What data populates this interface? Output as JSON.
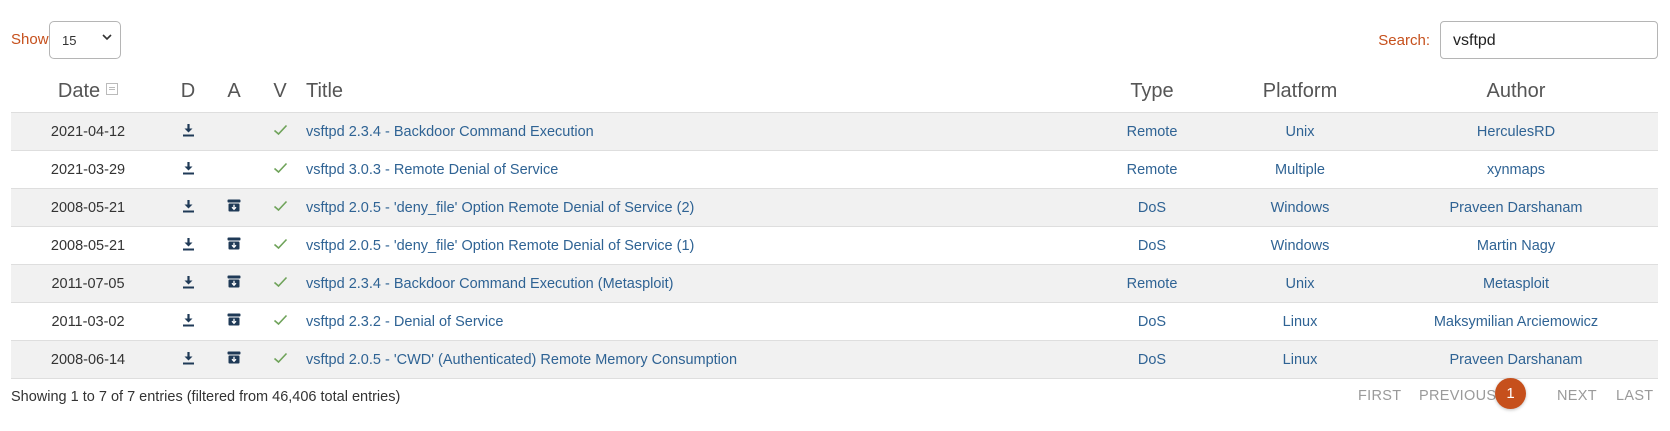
{
  "controls": {
    "show_label": "Show",
    "show_value": "15",
    "search_label": "Search:",
    "search_value": "vsftpd"
  },
  "table": {
    "headers": {
      "date": "Date",
      "download": "D",
      "app": "A",
      "verified": "V",
      "title": "Title",
      "type": "Type",
      "platform": "Platform",
      "author": "Author"
    },
    "rows": [
      {
        "date": "2021-04-12",
        "download": true,
        "app": false,
        "verified": true,
        "title": "vsftpd 2.3.4 - Backdoor Command Execution",
        "type": "Remote",
        "platform": "Unix",
        "author": "HerculesRD"
      },
      {
        "date": "2021-03-29",
        "download": true,
        "app": false,
        "verified": true,
        "title": "vsftpd 3.0.3 - Remote Denial of Service",
        "type": "Remote",
        "platform": "Multiple",
        "author": "xynmaps"
      },
      {
        "date": "2008-05-21",
        "download": true,
        "app": true,
        "verified": true,
        "title": "vsftpd 2.0.5 - 'deny_file' Option Remote Denial of Service (2)",
        "type": "DoS",
        "platform": "Windows",
        "author": "Praveen Darshanam"
      },
      {
        "date": "2008-05-21",
        "download": true,
        "app": true,
        "verified": true,
        "title": "vsftpd 2.0.5 - 'deny_file' Option Remote Denial of Service (1)",
        "type": "DoS",
        "platform": "Windows",
        "author": "Martin Nagy"
      },
      {
        "date": "2011-07-05",
        "download": true,
        "app": true,
        "verified": true,
        "title": "vsftpd 2.3.4 - Backdoor Command Execution (Metasploit)",
        "type": "Remote",
        "platform": "Unix",
        "author": "Metasploit"
      },
      {
        "date": "2011-03-02",
        "download": true,
        "app": true,
        "verified": true,
        "title": "vsftpd 2.3.2 - Denial of Service",
        "type": "DoS",
        "platform": "Linux",
        "author": "Maksymilian Arciemowicz"
      },
      {
        "date": "2008-06-14",
        "download": true,
        "app": true,
        "verified": true,
        "title": "vsftpd 2.0.5 - 'CWD' (Authenticated) Remote Memory Consumption",
        "type": "DoS",
        "platform": "Linux",
        "author": "Praveen Darshanam"
      }
    ]
  },
  "footer": {
    "info": "Showing 1 to 7 of 7 entries (filtered from 46,406 total entries)",
    "first": "FIRST",
    "previous": "PREVIOUS",
    "current_page": "1",
    "next": "NEXT",
    "last": "LAST"
  },
  "colors": {
    "accent": "#c6501c",
    "link": "#2f6394",
    "check": "#6fa35a",
    "stripe": "#f1f1f1"
  },
  "icons": {
    "download": "download-icon",
    "app": "archive-icon",
    "verified": "check-icon",
    "sort": "sort-icon",
    "dropdown": "chevron-down-icon"
  }
}
